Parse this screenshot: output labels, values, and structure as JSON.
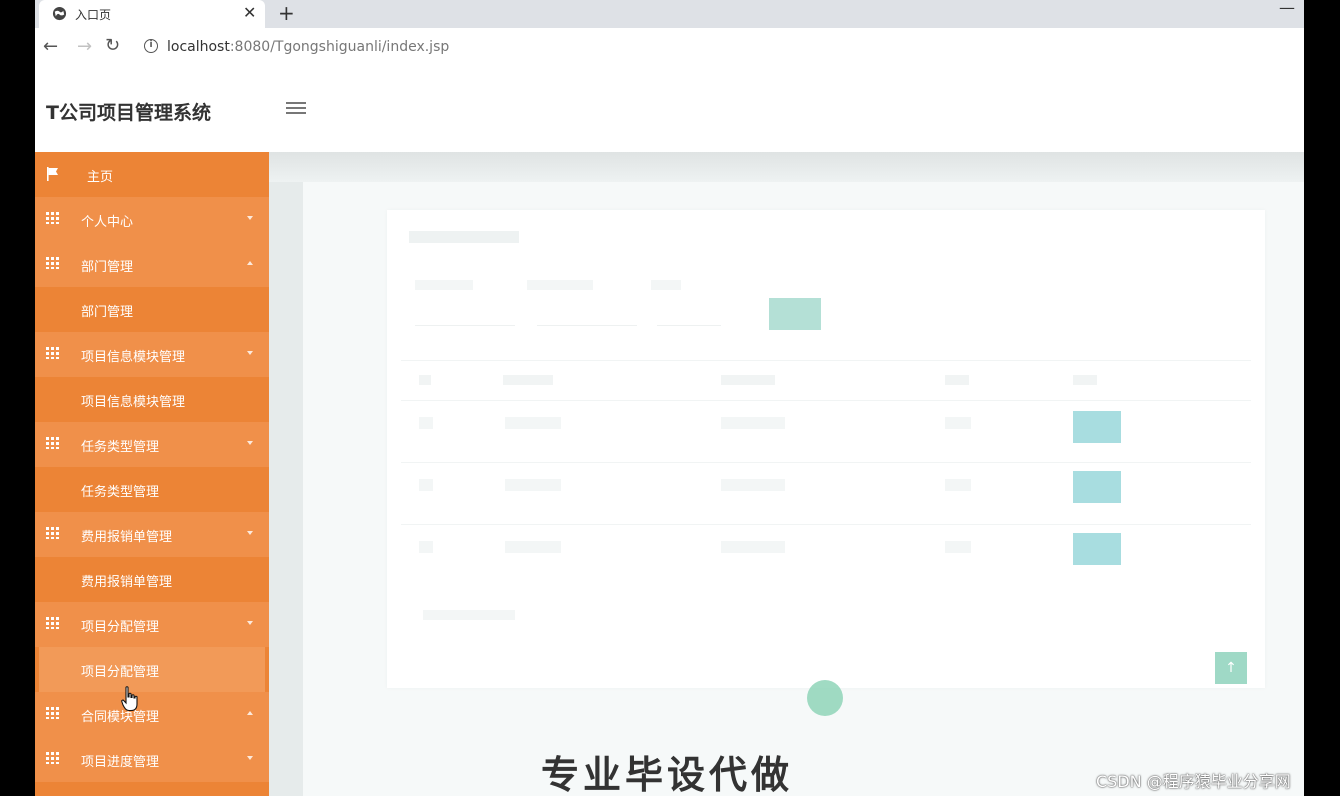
{
  "browser": {
    "tab_title": "入口页",
    "url_host": "localhost",
    "url_rest": ":8080/Tgongshiguanli/index.jsp",
    "new_tab": "+",
    "close": "✕",
    "minimize": "—"
  },
  "header": {
    "title": "T公司项目管理系统"
  },
  "sidebar": {
    "items": [
      {
        "label": "主页",
        "kind": "home"
      },
      {
        "label": "个人中心",
        "kind": "group",
        "expanded": false
      },
      {
        "label": "部门管理",
        "kind": "group",
        "expanded": true
      },
      {
        "label": "部门管理",
        "kind": "sub"
      },
      {
        "label": "项目信息模块管理",
        "kind": "group",
        "expanded": false
      },
      {
        "label": "项目信息模块管理",
        "kind": "sub"
      },
      {
        "label": "任务类型管理",
        "kind": "group",
        "expanded": false
      },
      {
        "label": "任务类型管理",
        "kind": "sub"
      },
      {
        "label": "费用报销单管理",
        "kind": "group",
        "expanded": false
      },
      {
        "label": "费用报销单管理",
        "kind": "sub"
      },
      {
        "label": "项目分配管理",
        "kind": "group",
        "expanded": false
      },
      {
        "label": "项目分配管理",
        "kind": "sub",
        "active": true
      },
      {
        "label": "合同模块管理",
        "kind": "group",
        "expanded": true
      },
      {
        "label": "项目进度管理",
        "kind": "group",
        "expanded": false
      }
    ]
  },
  "content": {
    "headline": "专业毕设代做"
  },
  "watermark": "CSDN @程序猿毕业分享网"
}
